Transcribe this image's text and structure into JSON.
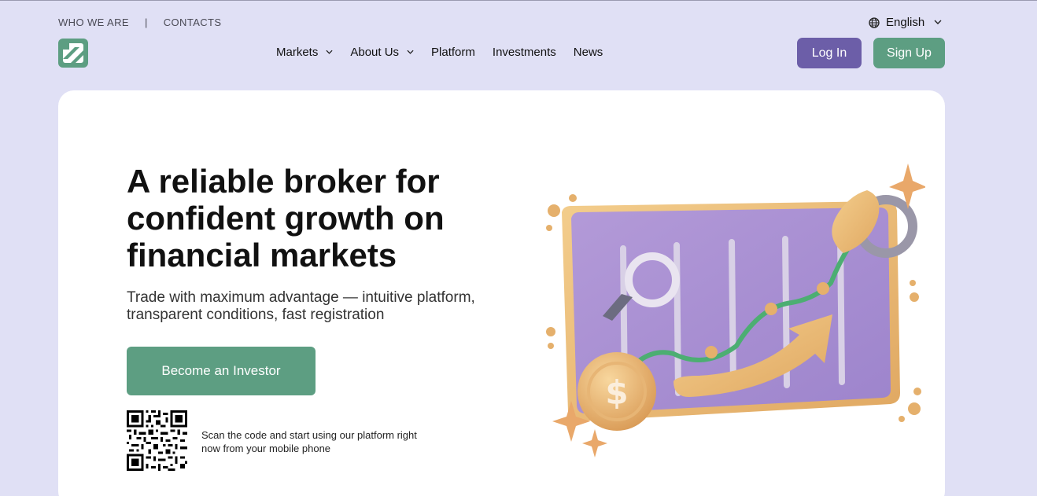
{
  "topbar": {
    "who_we_are": "WHO WE ARE",
    "separator": "|",
    "contacts": "CONTACTS"
  },
  "language": {
    "icon": "globe-icon",
    "label": "English",
    "chevron": "⌄"
  },
  "logo": {
    "icon": "brand-logo-icon",
    "color": "#5d9e82"
  },
  "nav": {
    "items": [
      {
        "label": "Markets",
        "has_dropdown": true
      },
      {
        "label": "About Us",
        "has_dropdown": true
      },
      {
        "label": "Platform",
        "has_dropdown": false
      },
      {
        "label": "Investments",
        "has_dropdown": false
      },
      {
        "label": "News",
        "has_dropdown": false
      }
    ],
    "chevron": "⌄"
  },
  "auth": {
    "login_label": "Log In",
    "signup_label": "Sign Up"
  },
  "hero": {
    "title": "A reliable broker for confident growth on financial markets",
    "subtitle": "Trade with maximum advantage — intuitive platform, transparent conditions, fast registration",
    "cta_label": "Become an Investor",
    "qr_text": "Scan the code and start using our platform right now from your mobile phone",
    "illustration": "growth-chart-illustration"
  },
  "colors": {
    "page_bg": "#e0e0f5",
    "card_bg": "#ffffff",
    "primary_purple": "#6c5ea8",
    "primary_green": "#5d9e82"
  }
}
